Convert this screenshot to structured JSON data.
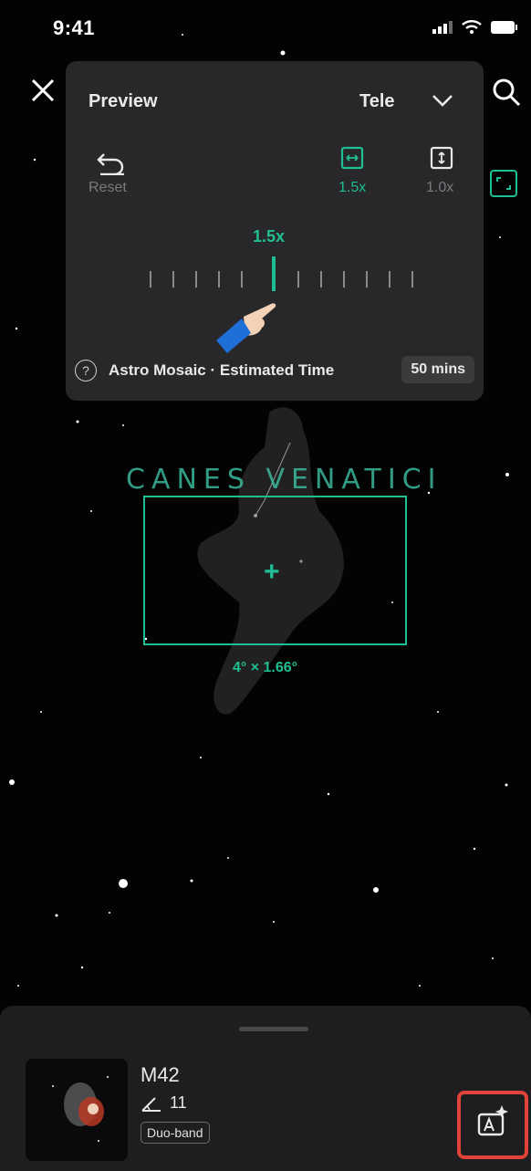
{
  "status_bar": {
    "time": "9:41"
  },
  "preview_panel": {
    "title": "Preview",
    "lens_select": "Tele",
    "reset_label": "Reset",
    "width_scale": "1.5x",
    "height_scale": "1.0x",
    "zoom_value": "1.5x",
    "mosaic_label": "Astro Mosaic · Estimated Time",
    "estimated_time": "50 mins"
  },
  "sky_view": {
    "constellation": "CANES VENATICI",
    "fov_size": "4° × 1.66°"
  },
  "target_card": {
    "name": "M42",
    "altitude": "11",
    "filter": "Duo-band"
  },
  "colors": {
    "accent": "#1fbf93",
    "highlight": "#e0433a"
  },
  "icons": [
    "close-icon",
    "search-icon",
    "frame-icon",
    "reset-icon",
    "width-icon",
    "height-icon",
    "help-icon",
    "altitude-icon",
    "astro-ai-icon"
  ]
}
